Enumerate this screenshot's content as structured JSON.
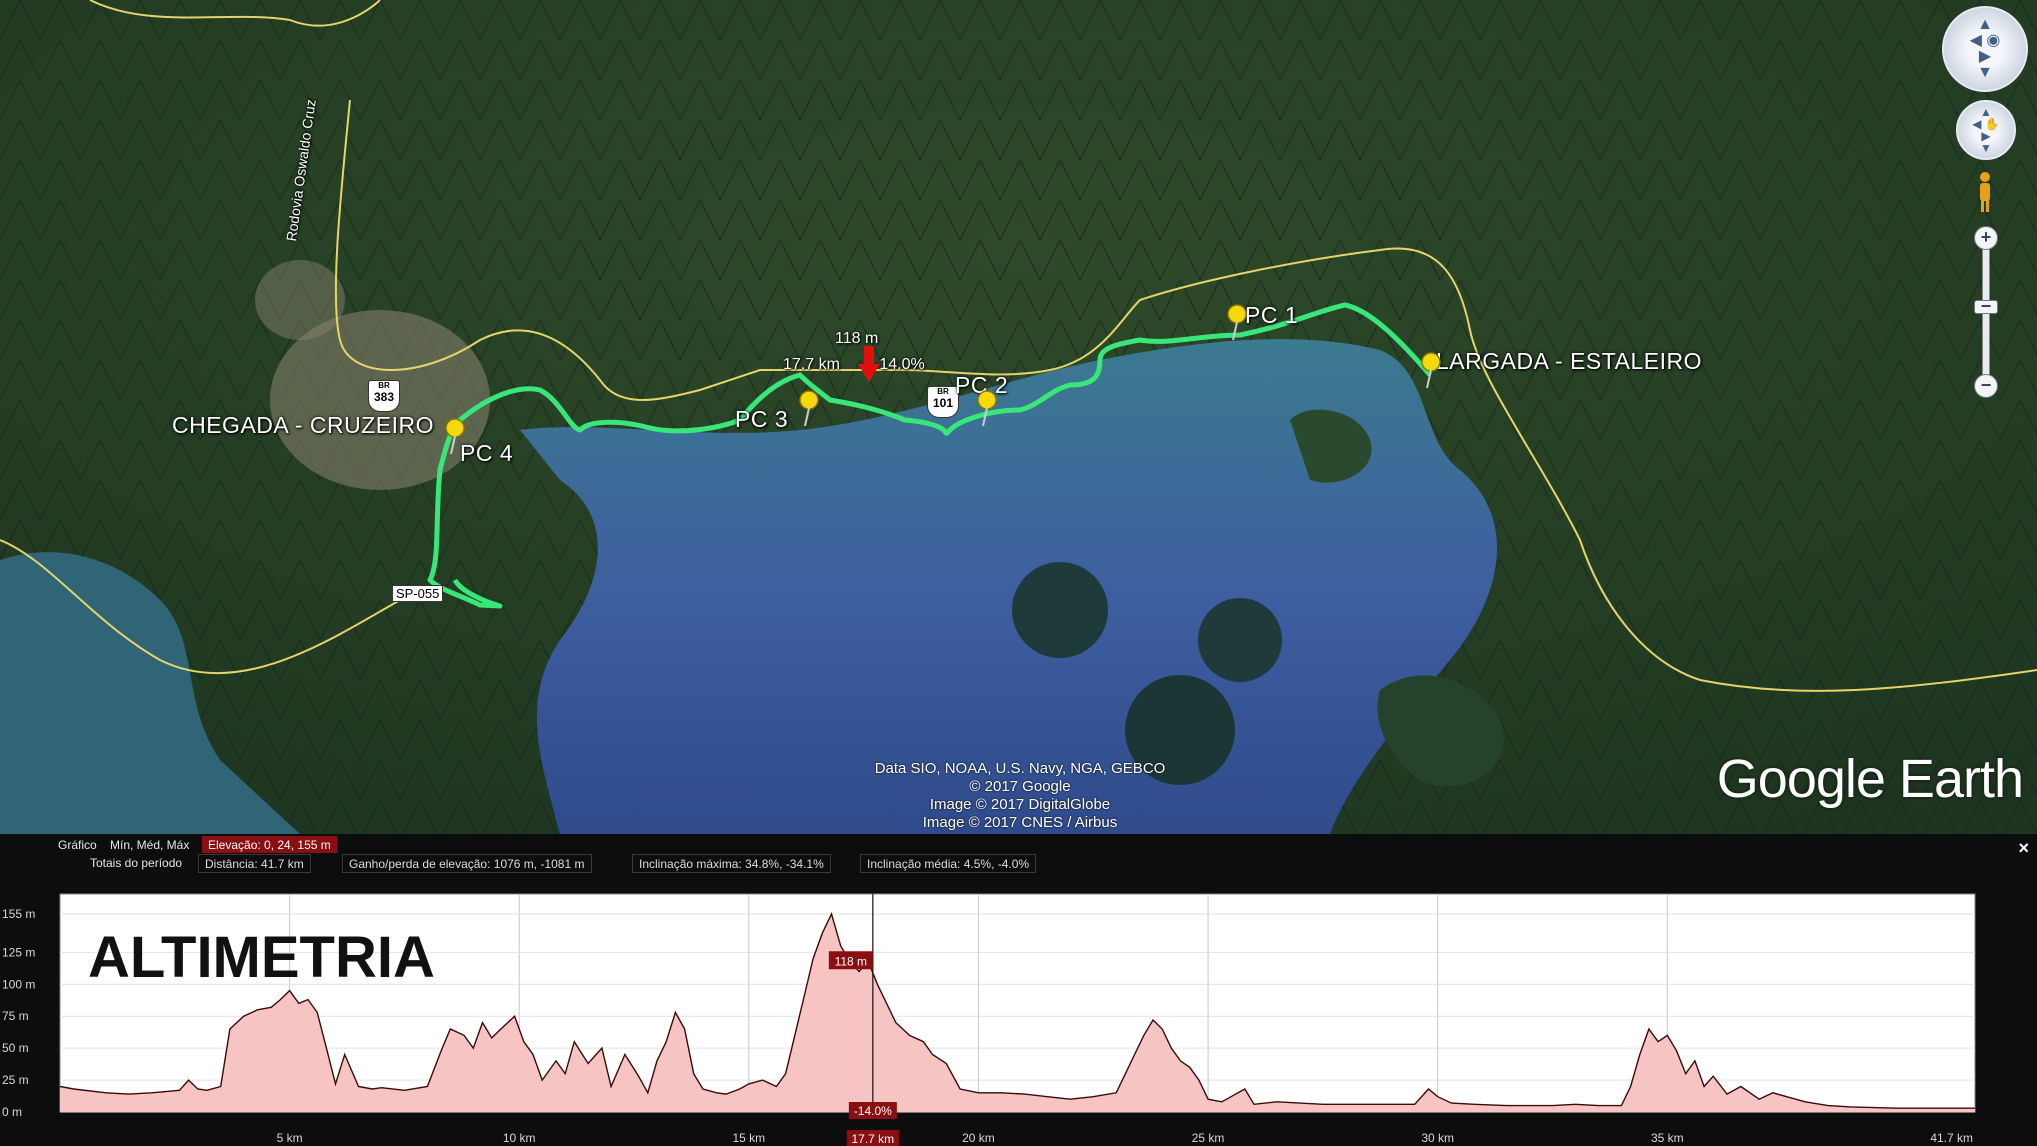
{
  "map": {
    "places": {
      "finish": "CHEGADA - CRUZEIRO",
      "start": "LARGADA - ESTALEIRO",
      "pc1": "PC 1",
      "pc2": "PC 2",
      "pc3": "PC 3",
      "pc4": "PC 4"
    },
    "road_label": "Rodovia Oswaldo Cruz",
    "shield_br383": "383",
    "shield_br101": "101",
    "shield_top": "BR",
    "road_tag": "SP-055",
    "cursor": {
      "elevation": "118 m",
      "distance": "17.7 km",
      "slope": "-14.0%"
    },
    "attribution": [
      "Data SIO, NOAA, U.S. Navy, NGA, GEBCO",
      "© 2017 Google",
      "Image © 2017 DigitalGlobe",
      "Image © 2017 CNES / Airbus"
    ],
    "brand": "Google Earth"
  },
  "panel": {
    "row1": {
      "label": "Gráfico",
      "mode": "Mín, Méd, Máx",
      "elevation": "Elevação: 0, 24, 155 m"
    },
    "row2": {
      "label": "Totais do período",
      "distance": "Distância: 41.7 km",
      "gain": "Ganho/perda de elevação: 1076 m, -1081 m",
      "max_slope": "Inclinação máxima: 34.8%, -34.1%",
      "avg_slope": "Inclinação média: 4.5%, -4.0%"
    },
    "close": "×"
  },
  "colors": {
    "track": "#39e67a",
    "profile_fill": "#f7c4c4",
    "profile_line": "#3b0a0a",
    "highlight": "#8a0f12",
    "pin": "#f5d90a"
  },
  "chart_data": {
    "type": "area",
    "title": "ALTIMETRIA",
    "xlabel": "",
    "ylabel": "",
    "xlim": [
      0,
      41.7
    ],
    "ylim": [
      0,
      155
    ],
    "x_ticks": [
      5,
      10,
      15,
      20,
      25,
      30,
      35
    ],
    "x_tick_labels": [
      "5 km",
      "10 km",
      "15 km",
      "20 km",
      "25 km",
      "30 km",
      "35 km"
    ],
    "x_end_label": "41.7 km",
    "y_ticks": [
      0,
      25,
      50,
      75,
      100,
      125,
      155
    ],
    "y_tick_labels": [
      "0 m",
      "25 m",
      "50 m",
      "75 m",
      "100 m",
      "125 m",
      "155 m"
    ],
    "cursor": {
      "x": 17.7,
      "elevation_label": "118 m",
      "slope_label": "-14.0%",
      "distance_label": "17.7 km"
    },
    "series": [
      {
        "x": [
          0,
          0.3,
          1,
          1.5,
          2,
          2.6,
          2.8,
          3,
          3.2,
          3.5,
          3.7,
          4,
          4.3,
          4.6,
          4.8,
          5,
          5.2,
          5.4,
          5.6,
          5.8,
          6,
          6.2,
          6.5,
          6.8,
          7,
          7.5,
          8,
          8,
          8.3,
          8.5,
          8.8,
          9,
          9.2,
          9.4,
          9.6,
          9.9,
          10.1,
          10.3,
          10.5,
          10.8,
          11,
          11.2,
          11.5,
          11.8,
          12,
          12.3,
          12.6,
          12.8,
          13,
          13.2,
          13.4,
          13.6,
          13.8,
          14,
          14.3,
          14.5,
          14.8,
          15,
          15.3,
          15.6,
          15.8,
          16,
          16.2,
          16.4,
          16.6,
          16.8,
          17,
          17.2,
          17.4,
          17.6,
          17.8,
          18,
          18.2,
          18.5,
          18.8,
          19,
          19.3,
          19.6,
          20,
          20.5,
          21,
          21.5,
          22,
          22.5,
          23,
          23.2,
          23.4,
          23.6,
          23.8,
          24,
          24.2,
          24.4,
          24.6,
          24.8,
          25,
          25.3,
          25.5,
          25.8,
          26,
          26.5,
          27,
          27.5,
          28,
          28.5,
          29,
          29.5,
          29.8,
          30,
          30.3,
          30.8,
          31.5,
          32,
          32.5,
          33,
          33.5,
          34,
          34.2,
          34.4,
          34.6,
          34.8,
          35,
          35.2,
          35.4,
          35.6,
          35.8,
          36,
          36.3,
          36.6,
          37,
          37.3,
          37.6,
          38,
          38.5,
          39,
          40,
          41,
          41.7
        ],
        "values": [
          20,
          18,
          15,
          14,
          15,
          17,
          25,
          18,
          17,
          20,
          65,
          75,
          80,
          82,
          88,
          95,
          85,
          88,
          78,
          50,
          22,
          45,
          20,
          18,
          19,
          17,
          20,
          20,
          48,
          65,
          60,
          50,
          70,
          58,
          65,
          75,
          55,
          45,
          25,
          40,
          30,
          55,
          38,
          50,
          20,
          45,
          28,
          15,
          40,
          55,
          78,
          65,
          30,
          18,
          15,
          14,
          18,
          22,
          25,
          20,
          30,
          60,
          90,
          120,
          140,
          155,
          130,
          118,
          110,
          118,
          100,
          85,
          70,
          60,
          55,
          45,
          38,
          18,
          15,
          15,
          14,
          12,
          10,
          12,
          15,
          30,
          45,
          60,
          72,
          65,
          50,
          40,
          35,
          25,
          10,
          8,
          12,
          18,
          6,
          8,
          7,
          6,
          6,
          6,
          6,
          6,
          18,
          12,
          7,
          6,
          5,
          5,
          5,
          6,
          5,
          5,
          20,
          45,
          65,
          55,
          60,
          48,
          30,
          40,
          20,
          28,
          14,
          20,
          10,
          15,
          12,
          8,
          5,
          4,
          3,
          3,
          3
        ]
      }
    ]
  }
}
